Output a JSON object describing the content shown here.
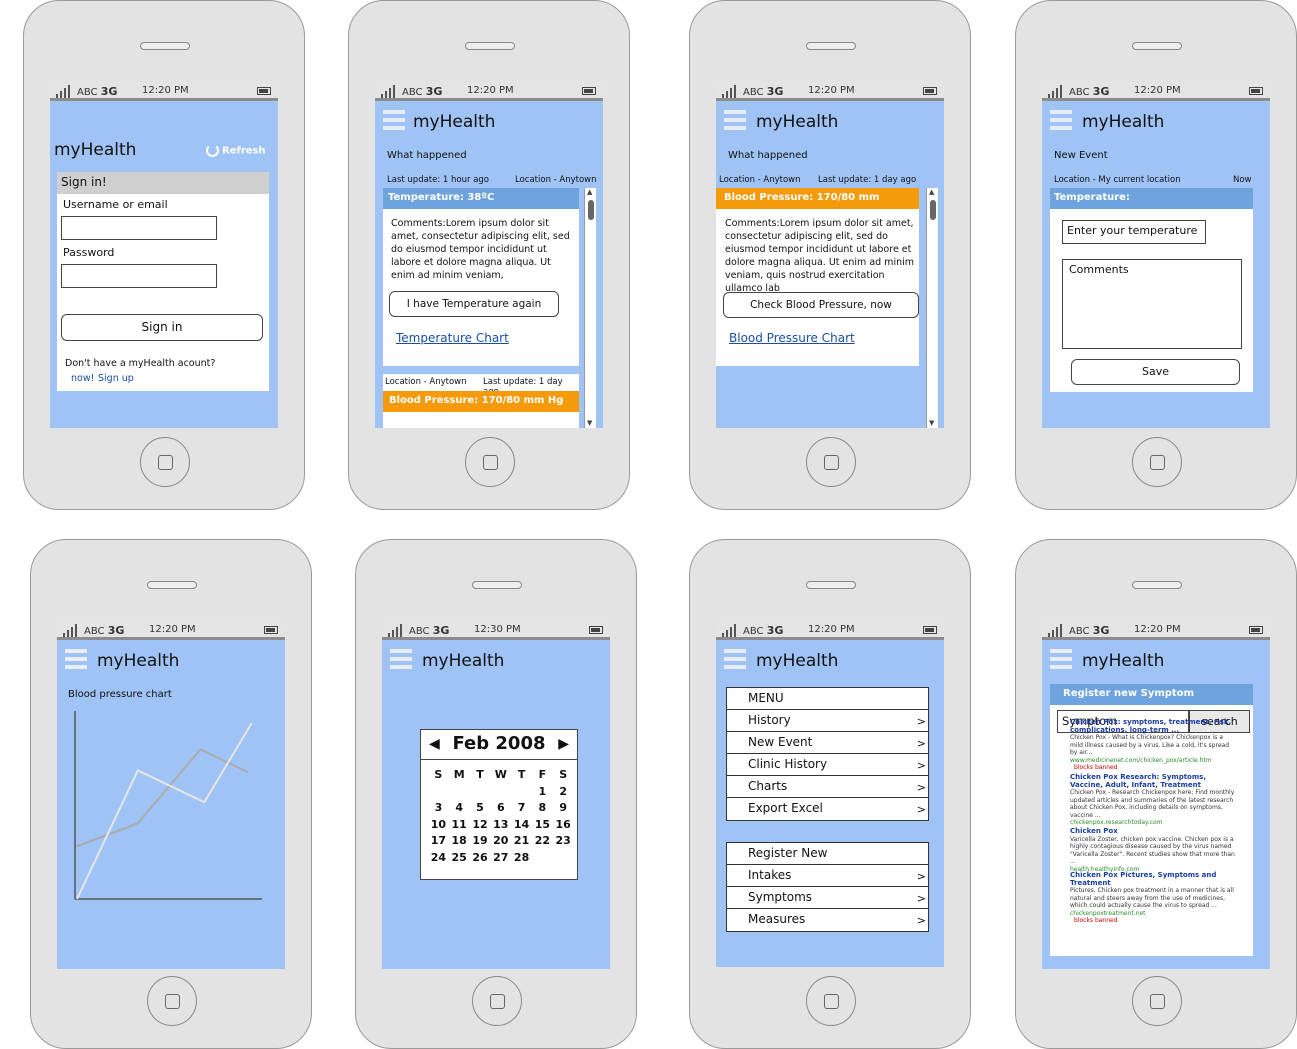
{
  "status": {
    "carrier": "ABC",
    "network": "3G",
    "time": "12:20 PM",
    "time_calendar": "12:30 PM"
  },
  "app": {
    "title": "myHealth"
  },
  "login": {
    "refresh": "Refresh",
    "header": "Sign in!",
    "username_label": "Username or email",
    "password_label": "Password",
    "signin_button": "Sign in",
    "no_account": "Don't have a myHealth acount?",
    "now": "now!",
    "signup": "Sign up"
  },
  "history": {
    "heading": "What happened",
    "entry1": {
      "last_update": "Last update: 1 hour ago",
      "location": "Location - Anytown",
      "title": "Temperature: 38ºC",
      "comments": "Comments:Lorem ipsum dolor sit amet, consectetur adipiscing elit, sed do eiusmod tempor incididunt ut labore et dolore magna aliqua. Ut enim ad minim veniam,",
      "button": "I have Temperature again",
      "chart_link": "Temperature Chart"
    },
    "entry2": {
      "location": "Location - Anytown",
      "last_update": "Last update: 1 day ago",
      "title": "Blood Pressure: 170/80 mm Hg"
    }
  },
  "bp_detail": {
    "heading": "What happened",
    "location": "Location - Anytown",
    "last_update": "Last update: 1 day ago",
    "title": "Blood Pressure: 170/80 mm",
    "comments": "Comments:Lorem ipsum dolor sit amet, consectetur adipiscing elit, sed do eiusmod tempor incididunt ut labore et dolore magna aliqua. Ut enim ad minim veniam, quis nostrud exercitation ullamco lab",
    "button": "Check Blood Pressure, now",
    "chart_link": "Blood Pressure Chart"
  },
  "new_event": {
    "heading": "New Event",
    "location": "Location - My current location",
    "when": "Now",
    "section": "Temperature:",
    "temp_placeholder": "Enter your temperature",
    "comments_placeholder": "Comments",
    "save": "Save"
  },
  "bp_chart": {
    "label": "Blood pressure chart"
  },
  "chart_data": {
    "type": "line",
    "title": "Blood pressure chart",
    "xlabel": "",
    "ylabel": "",
    "series": [
      {
        "values": [
          [
            0,
            0.3
          ],
          [
            0.32,
            0.43
          ],
          [
            0.65,
            0.85
          ],
          [
            0.9,
            0.72
          ]
        ]
      },
      {
        "values": [
          [
            0,
            0.0
          ],
          [
            0.32,
            0.73
          ],
          [
            0.67,
            0.55
          ],
          [
            0.92,
            1.0
          ]
        ]
      }
    ]
  },
  "calendar": {
    "month": "Feb 2008",
    "weekdays": [
      "S",
      "M",
      "T",
      "W",
      "T",
      "F",
      "S"
    ],
    "weeks": [
      [
        "",
        "",
        "",
        "",
        "",
        "1",
        "2"
      ],
      [
        "3",
        "4",
        "5",
        "6",
        "7",
        "8",
        "9"
      ],
      [
        "10",
        "11",
        "12",
        "13",
        "14",
        "15",
        "16"
      ],
      [
        "17",
        "18",
        "19",
        "20",
        "21",
        "22",
        "23"
      ],
      [
        "24",
        "25",
        "26",
        "27",
        "28",
        "",
        ""
      ]
    ]
  },
  "menu": {
    "group1": [
      {
        "label": "MENU",
        "chevron": false
      },
      {
        "label": "History",
        "chevron": true
      },
      {
        "label": "New Event",
        "chevron": true
      },
      {
        "label": "Clinic History",
        "chevron": true
      },
      {
        "label": "Charts",
        "chevron": true
      },
      {
        "label": "Export Excel",
        "chevron": true
      }
    ],
    "group2": [
      {
        "label": "Register New",
        "chevron": false
      },
      {
        "label": "Intakes",
        "chevron": true
      },
      {
        "label": "Symptoms",
        "chevron": true
      },
      {
        "label": "Measures",
        "chevron": true
      }
    ]
  },
  "symptom": {
    "header": "Register new Symptom",
    "input_value": "Symptom",
    "search_button": "search",
    "results": [
      {
        "title": "Chicken Pox: symptoms, treatment, risk, complications, long-term ...",
        "snippet": "Chicken Pox - What is Chickenpox? Chickenpox is a mild illness caused by a virus. Like a cold, it's spread by air...",
        "url": "www.medicinenet.com/chicken_pox/article.htm",
        "flag": "blocks banned"
      },
      {
        "title": "Chicken Pox Research: Symptoms, Vaccine, Adult, Infant, Treatment",
        "snippet": "Chicken Pox - Research Chickenpox here: Find monthly updated articles and summaries of the latest research about Chicken Pox, including details on symptoms, vaccine ...",
        "url": "chickenpox.researchtoday.com",
        "flag": ""
      },
      {
        "title": "Chicken Pox",
        "snippet": "Varicella Zoster, chicken pox vaccine. Chicken pox is a highly contagious disease caused by the virus named \"Varicella Zoster\". Recent studies show that more than ...",
        "url": "health.healthyinfo.com",
        "flag": ""
      },
      {
        "title": "Chicken Pox Pictures, Symptoms and Treatment",
        "snippet": "Pictures, Chicken pox treatment in a manner that is all natural and steers away from the use of medicines, which could actually cause the virus to spread ...",
        "url": "chickenpoxtreatment.net",
        "flag": "blocks banned"
      }
    ]
  }
}
